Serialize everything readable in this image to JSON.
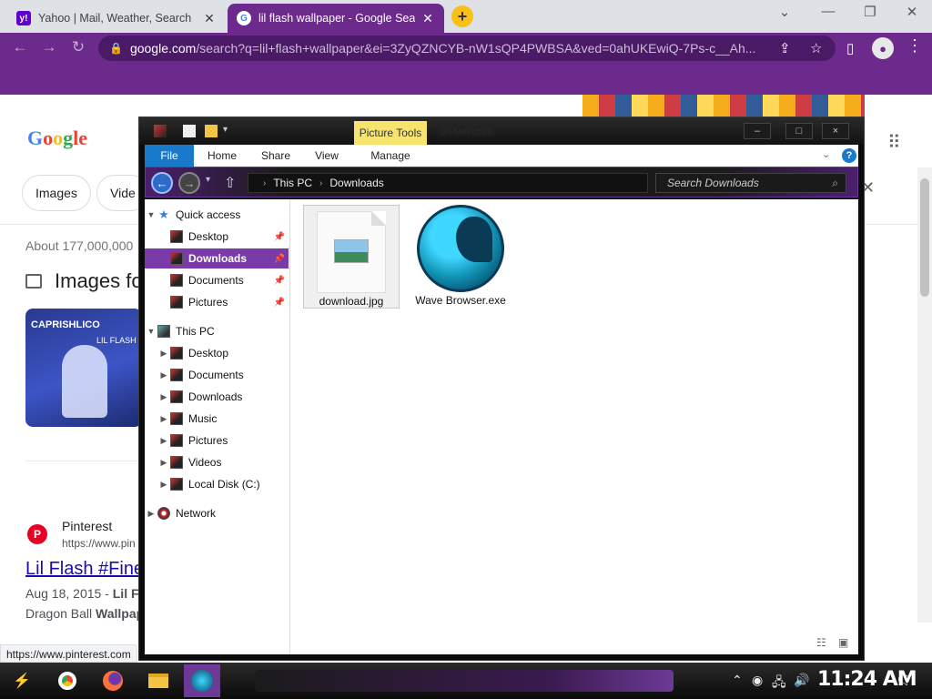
{
  "browser": {
    "tabs": [
      {
        "title": "Yahoo | Mail, Weather, Search",
        "favicon": "yahoo-icon",
        "close": "✕"
      },
      {
        "title": "lil flash wallpaper - Google Search",
        "favicon": "google-icon",
        "close": "✕"
      }
    ],
    "new_tab": "+",
    "window_controls": {
      "minimize": "⌄",
      "min2": "—",
      "restore": "❐",
      "close": "✕"
    },
    "nav": {
      "back": "←",
      "forward": "→",
      "reload": "↻"
    },
    "address": {
      "domain": "google.com",
      "path": "/search?q=lil+flash+wallpaper&ei=3ZyQZNCYB-nW1sQP4PWBSA&ved=0ahUKEwiQ-7Ps-c__Ah..."
    },
    "accent_color": "#6b2a8c"
  },
  "google": {
    "logo_letters": [
      "G",
      "o",
      "o",
      "g",
      "le"
    ],
    "chips": [
      "Images",
      "Vide"
    ],
    "stats": "About 177,000,000",
    "images_heading": "Images fo",
    "thumb_title": "CAPRISHLICO",
    "thumb_sub": "LIL FLASH",
    "result": {
      "site": "Pinterest",
      "url": "https://www.pin",
      "title": "Lil Flash #Fine",
      "date": "Aug 18, 2015 - ",
      "snippet_bold": "Lil Fl",
      "snippet2_a": "Dragon Ball ",
      "snippet2_b": "Wallpap"
    },
    "status_url": "https://www.pinterest.com"
  },
  "explorer": {
    "context_tab": "Picture Tools",
    "window_title": "Downloads",
    "controls": {
      "min": "–",
      "max": "□",
      "close": "×"
    },
    "ribbon_tabs": [
      "File",
      "Home",
      "Share",
      "View",
      "Manage"
    ],
    "help": "?",
    "breadcrumb": [
      "This PC",
      "Downloads"
    ],
    "search_placeholder": "Search Downloads",
    "nav": {
      "quick_access": "Quick access",
      "quick_items": [
        "Desktop",
        "Downloads",
        "Documents",
        "Pictures"
      ],
      "this_pc": "This PC",
      "pc_items": [
        "Desktop",
        "Documents",
        "Downloads",
        "Music",
        "Pictures",
        "Videos",
        "Local Disk (C:)"
      ],
      "network": "Network"
    },
    "files": [
      {
        "name": "download.jpg",
        "icon": "image-file-icon"
      },
      {
        "name": "Wave Browser.exe",
        "icon": "wave-browser-icon"
      }
    ]
  },
  "taskbar": {
    "apps": [
      "start-icon",
      "chrome-icon",
      "firefox-icon",
      "file-explorer-icon",
      "wave-browser-icon"
    ],
    "clock": "11:24 AM"
  }
}
